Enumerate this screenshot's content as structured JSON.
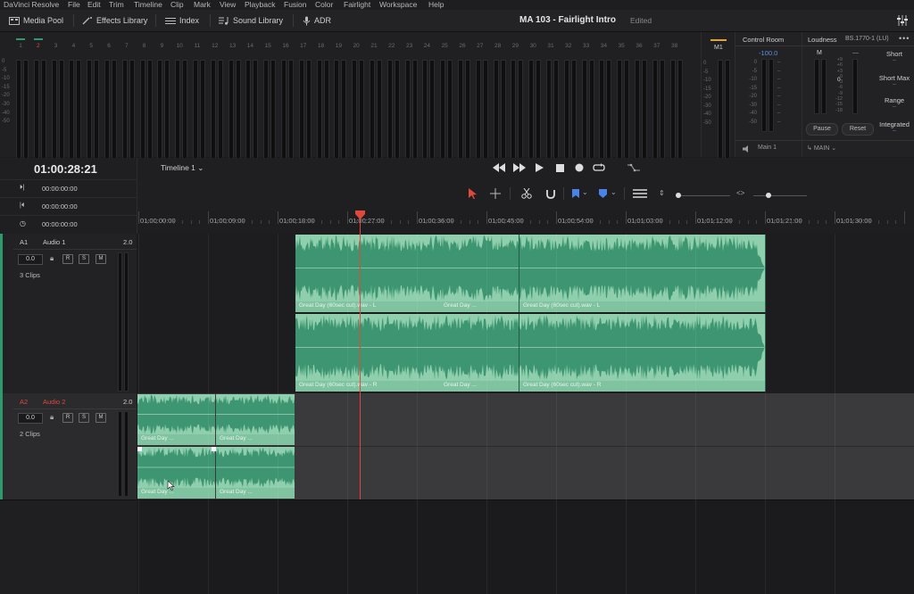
{
  "menu": [
    "DaVinci Resolve",
    "File",
    "Edit",
    "Trim",
    "Timeline",
    "Clip",
    "Mark",
    "View",
    "Playback",
    "Fusion",
    "Color",
    "Fairlight",
    "Workspace",
    "Help"
  ],
  "toolbar": {
    "media_pool": "Media Pool",
    "effects_library": "Effects Library",
    "index": "Index",
    "sound_library": "Sound Library",
    "adr": "ADR",
    "project_title": "MA 103 - Fairlight Intro",
    "project_status": "Edited"
  },
  "meters": {
    "channel_numbers": [
      "1",
      "2",
      "3",
      "4",
      "5",
      "6",
      "7",
      "8",
      "9",
      "10",
      "11",
      "12",
      "13",
      "14",
      "15",
      "16",
      "17",
      "18",
      "19",
      "20",
      "21",
      "22",
      "23",
      "24",
      "25",
      "26",
      "27",
      "28",
      "29",
      "30",
      "31",
      "32",
      "33",
      "34",
      "35",
      "36",
      "37",
      "38"
    ],
    "scale": [
      "0",
      "-5",
      "-10",
      "-15",
      "-20",
      "-30",
      "-40",
      "-50"
    ],
    "bus_label": "M1"
  },
  "control_room": {
    "title": "Control Room",
    "level": "-100.0",
    "scale": [
      "0",
      "-5",
      "-10",
      "-15",
      "-20",
      "-30",
      "-40",
      "-50"
    ],
    "monitor": "Main 1",
    "output": "MAIN"
  },
  "loudness": {
    "title": "Loudness",
    "standard": "BS.1770-1 (LU)",
    "channel": "M",
    "scale_left": [
      "+9",
      "+6",
      "+3",
      "0",
      "-3",
      "-6",
      "-9",
      "-12",
      "-15",
      "-18"
    ],
    "center_value": "0",
    "labels": [
      "Short",
      "Short Max",
      "Range",
      "Integrated"
    ],
    "dashes": [
      "--",
      "--",
      "--",
      "--"
    ],
    "pause": "Pause",
    "reset": "Reset"
  },
  "timecode": {
    "main": "01:00:28:21",
    "rows": [
      "00:00:00:00",
      "00:00:00:00",
      "00:00:00:00"
    ]
  },
  "timeline": {
    "name": "Timeline 1",
    "ruler": [
      "01:00:00:00",
      "01:00:09:00",
      "01:00:18:00",
      "01:00:27:00",
      "01:00:36:00",
      "01:00:45:00",
      "01:00:54:00",
      "01:01:03:00",
      "01:01:12:00",
      "01:01:21:00",
      "01:01:30:00"
    ]
  },
  "tracks": [
    {
      "id": "A1",
      "name": "Audio 1",
      "format": "2.0",
      "volume": "0.0",
      "clips": "3 Clips"
    },
    {
      "id": "A2",
      "name": "Audio 2",
      "format": "2.0",
      "volume": "0.0",
      "clips": "2 Clips"
    }
  ],
  "track_buttons": [
    "R",
    "S",
    "M"
  ],
  "clips_a1": {
    "top": [
      "Great Day (60sec cut).wav - L",
      "Great Day ...",
      "Great Day (60sec cut).wav - L"
    ],
    "bottom": [
      "Great Day (60sec cut).wav - R",
      "Great Day ...",
      "Great Day (60sec cut).wav - R"
    ]
  },
  "clips_a2": [
    "Great Day ...",
    "Great Day ...",
    "Great Day ...",
    "Great Day ..."
  ],
  "colors": {
    "clip_green": "#8fcfae",
    "wave_green": "#2f8c66",
    "selection_red": "#d8463c",
    "playhead": "#e0483d",
    "accent_blue": "#4a82e8"
  }
}
